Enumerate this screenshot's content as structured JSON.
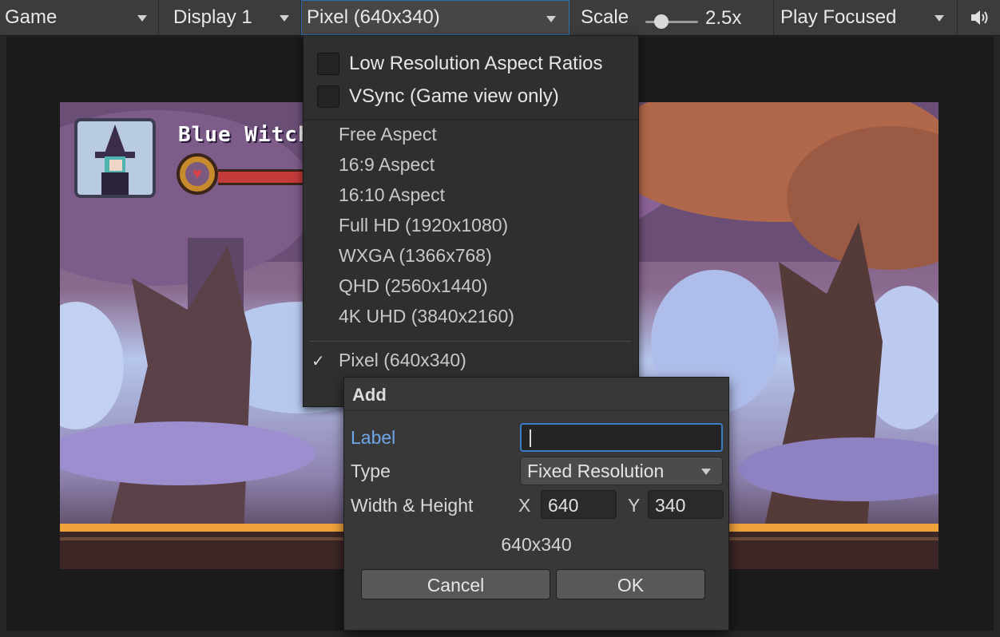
{
  "toolbar": {
    "game_tab": "Game",
    "display": "Display 1",
    "resolution": "Pixel (640x340)",
    "scale_label": "Scale",
    "scale_value": "2.5x",
    "play_mode": "Play Focused",
    "audio_icon": "speaker-icon"
  },
  "game": {
    "character_name": "Blue Witch",
    "heart_icon": "heart-icon"
  },
  "dropdown": {
    "options": {
      "low_res": "Low Resolution Aspect Ratios",
      "vsync": "VSync (Game view only)"
    },
    "items": [
      "Free Aspect",
      "16:9 Aspect",
      "16:10 Aspect",
      "Full HD (1920x1080)",
      "WXGA (1366x768)",
      "QHD (2560x1440)",
      "4K UHD (3840x2160)"
    ],
    "selected": "Pixel (640x340)",
    "check_glyph": "✓"
  },
  "dialog": {
    "title": "Add",
    "label_caption": "Label",
    "label_value": "",
    "type_caption": "Type",
    "type_value": "Fixed Resolution",
    "size_caption": "Width & Height",
    "x_axis": "X",
    "width": "640",
    "y_axis": "Y",
    "height": "340",
    "summary": "640x340",
    "cancel": "Cancel",
    "ok": "OK"
  },
  "colors": {
    "accent": "#3d7cc9",
    "label_highlight": "#6fa6e8"
  }
}
